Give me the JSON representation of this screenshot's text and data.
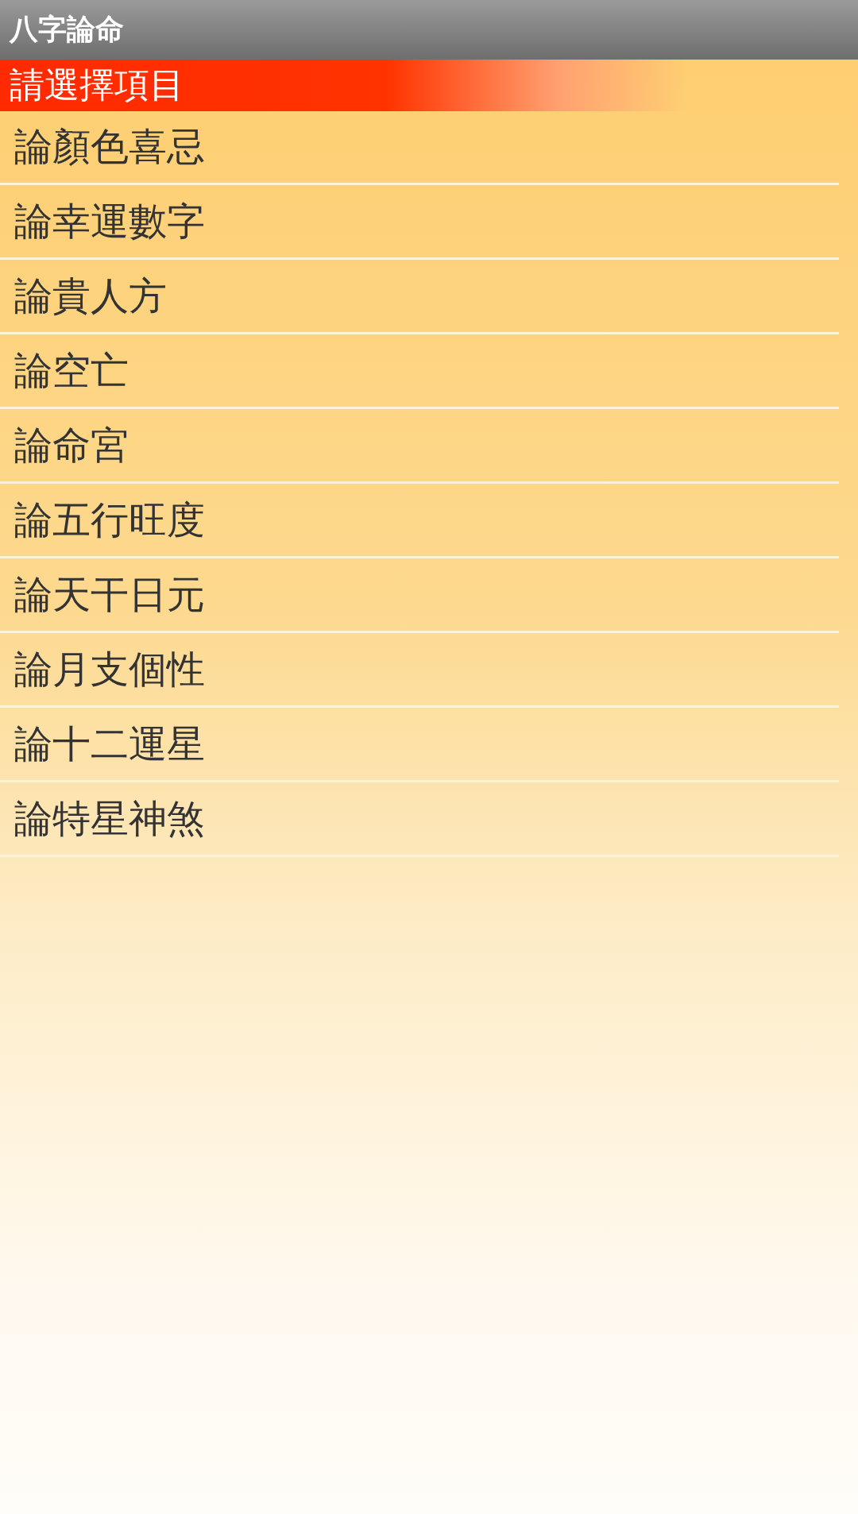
{
  "title_bar": {
    "title": "八字論命"
  },
  "header": {
    "label": "請選擇項目"
  },
  "items": [
    {
      "label": "論顏色喜忌"
    },
    {
      "label": "論幸運數字"
    },
    {
      "label": "論貴人方"
    },
    {
      "label": "論空亡"
    },
    {
      "label": "論命宮"
    },
    {
      "label": "論五行旺度"
    },
    {
      "label": "論天干日元"
    },
    {
      "label": "論月支個性"
    },
    {
      "label": "論十二運星"
    },
    {
      "label": "論特星神煞"
    }
  ]
}
